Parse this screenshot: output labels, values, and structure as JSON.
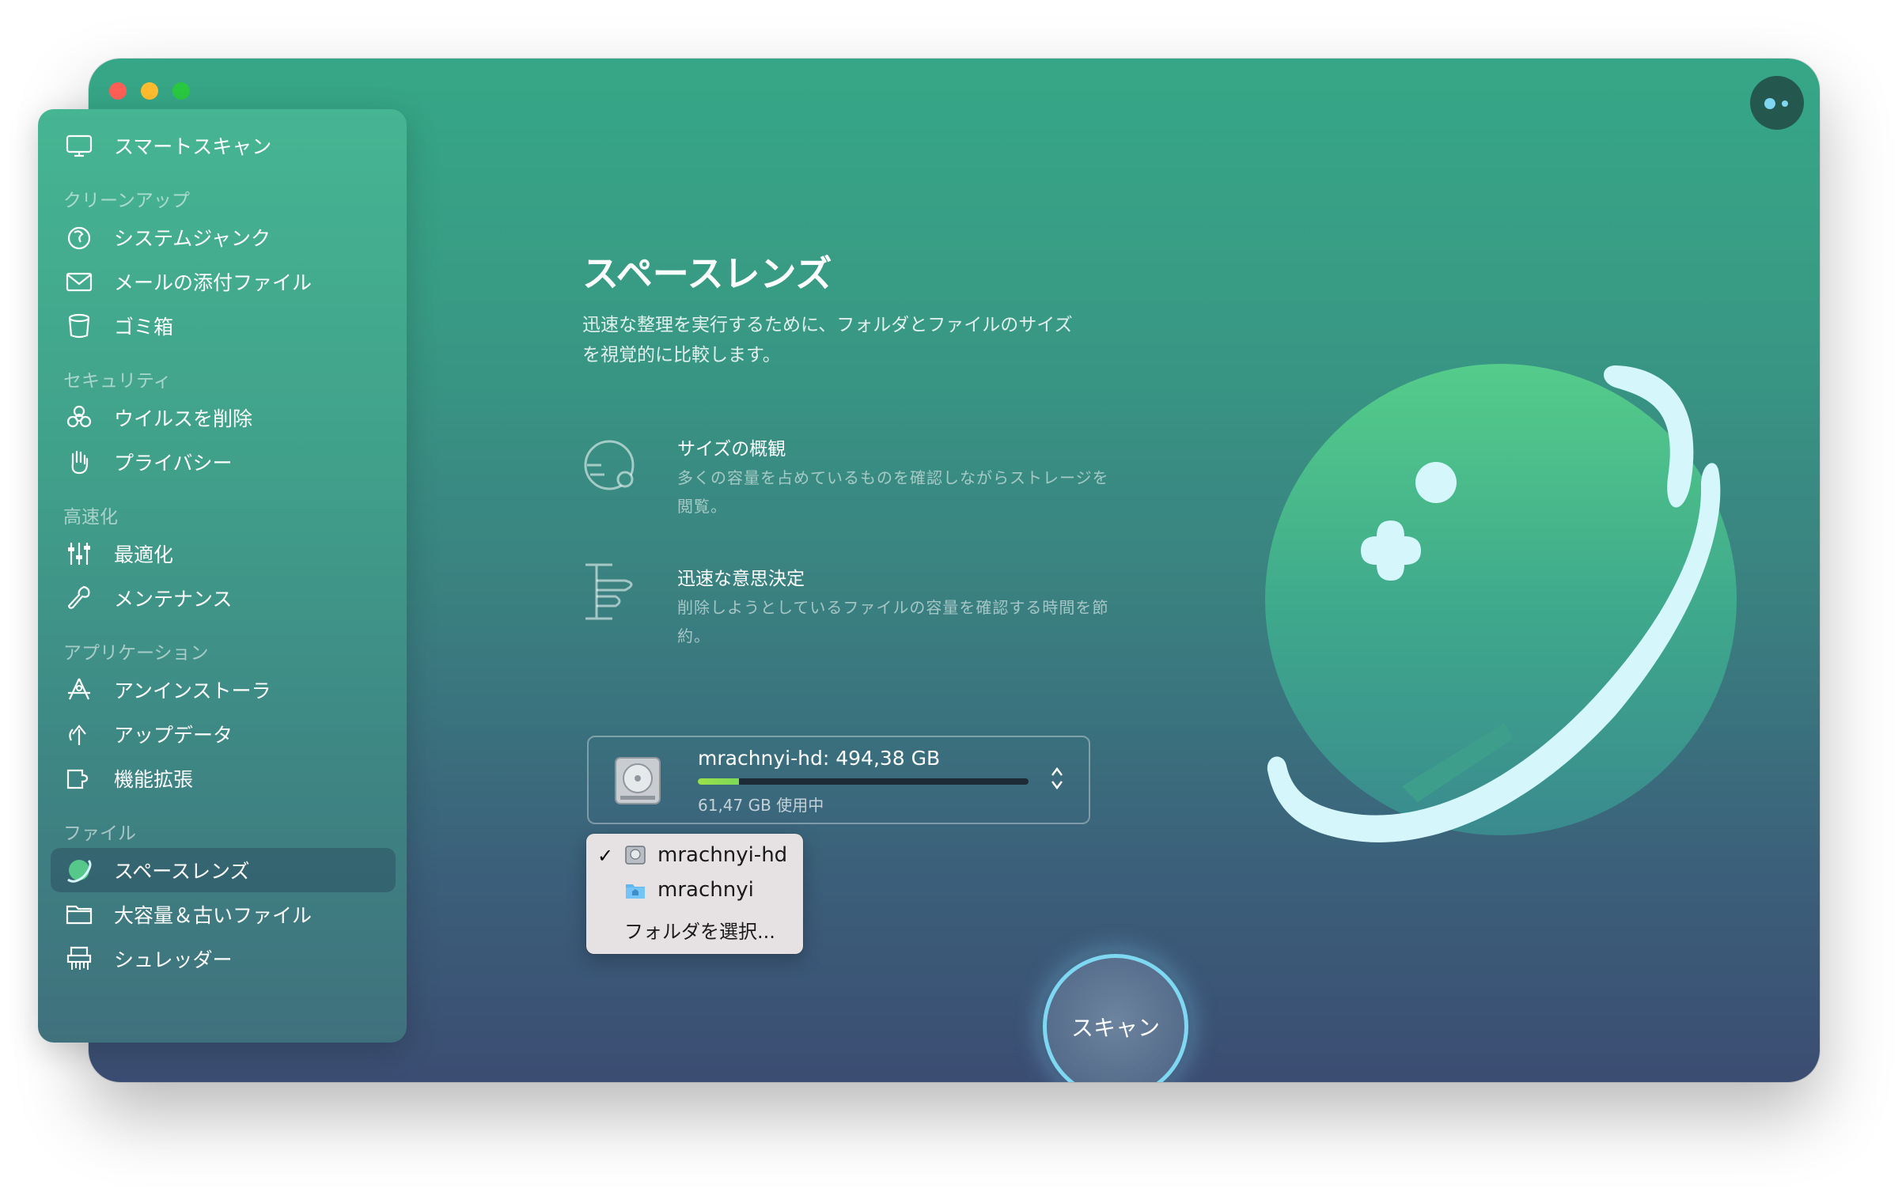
{
  "window": {
    "accent": "#36a786"
  },
  "sidebar": {
    "smart_scan": "スマートスキャン",
    "sections": {
      "cleanup": "クリーンアップ",
      "security": "セキュリティ",
      "speed": "高速化",
      "apps": "アプリケーション",
      "files": "ファイル"
    },
    "items": [
      {
        "label": "システムジャンク",
        "icon": "system-junk-icon"
      },
      {
        "label": "メールの添付ファイル",
        "icon": "mail-icon"
      },
      {
        "label": "ゴミ箱",
        "icon": "trash-icon"
      },
      {
        "label": "ウイルスを削除",
        "icon": "biohazard-icon"
      },
      {
        "label": "プライバシー",
        "icon": "hand-icon"
      },
      {
        "label": "最適化",
        "icon": "sliders-icon"
      },
      {
        "label": "メンテナンス",
        "icon": "wrench-icon"
      },
      {
        "label": "アンインストーラ",
        "icon": "app-store-icon"
      },
      {
        "label": "アップデータ",
        "icon": "update-icon"
      },
      {
        "label": "機能拡張",
        "icon": "puzzle-icon"
      },
      {
        "label": "スペースレンズ",
        "icon": "space-lens-icon",
        "selected": true
      },
      {
        "label": "大容量＆古いファイル",
        "icon": "folder-icon"
      },
      {
        "label": "シュレッダー",
        "icon": "shredder-icon"
      }
    ]
  },
  "main": {
    "title": "スペースレンズ",
    "description": "迅速な整理を実行するために、フォルダとファイルのサイズを視覚的に比較します。",
    "features": [
      {
        "title": "サイズの概観",
        "desc": "多くの容量を占めているものを確認しながらストレージを閲覧。"
      },
      {
        "title": "迅速な意思決定",
        "desc": "削除しようとしているファイルの容量を確認する時間を節約。"
      }
    ],
    "disk": {
      "name": "mrachnyi-hd: 494,38 GB",
      "used": "61,47 GB 使用中",
      "used_fraction": 0.124
    },
    "dropdown": {
      "items": [
        {
          "label": "mrachnyi-hd",
          "checked": true,
          "icon": "hard-drive-icon"
        },
        {
          "label": "mrachnyi",
          "checked": false,
          "icon": "home-folder-icon"
        },
        {
          "label": "フォルダを選択...",
          "checked": false
        }
      ]
    },
    "scan_button": "スキャン"
  }
}
